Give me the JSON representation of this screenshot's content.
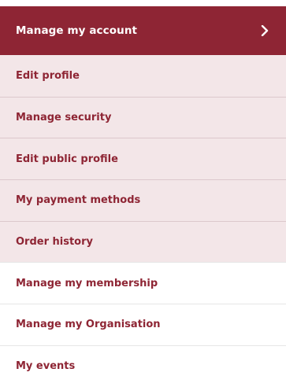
{
  "menu": {
    "header_label": "Manage my account",
    "header_icon": "chevron-right-icon",
    "colors": {
      "accent": "#8e2534",
      "submenu_bg": "#f3e6e8",
      "text_on_accent": "#ffffff"
    },
    "submenu": [
      {
        "label": "Edit profile"
      },
      {
        "label": "Manage security"
      },
      {
        "label": "Edit public profile"
      },
      {
        "label": "My payment methods"
      },
      {
        "label": "Order history"
      }
    ],
    "other": [
      {
        "label": "Manage my membership"
      },
      {
        "label": "Manage my Organisation"
      },
      {
        "label": "My events"
      }
    ]
  }
}
